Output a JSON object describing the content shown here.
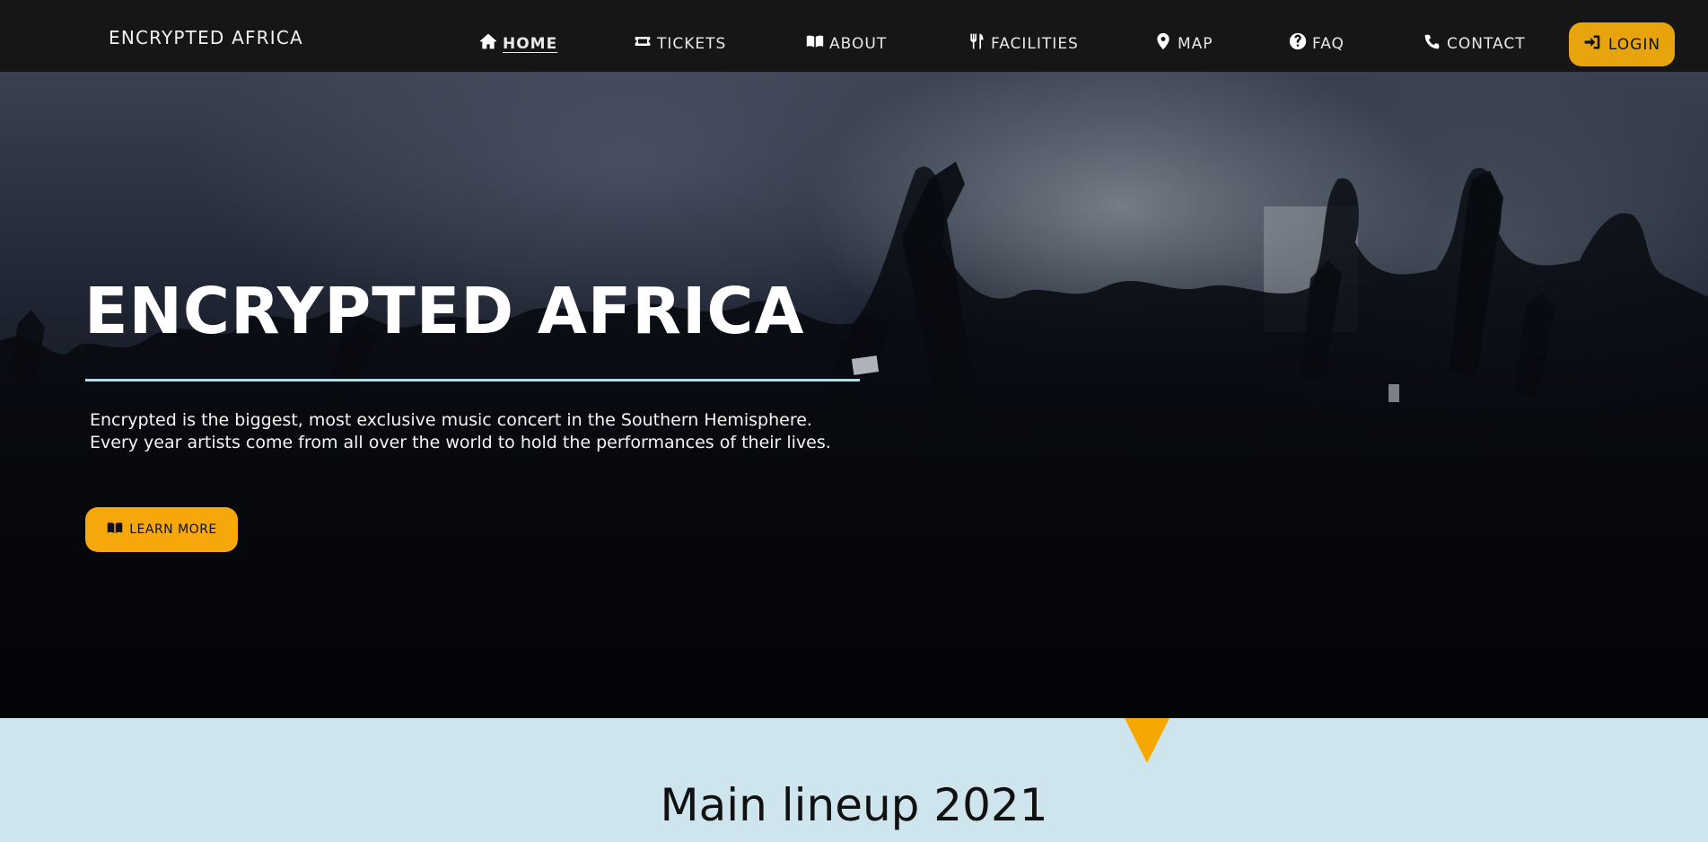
{
  "brand": "ENCRYPTED AFRICA",
  "nav": {
    "items": [
      {
        "label": "HOME",
        "icon": "home-icon",
        "active": true
      },
      {
        "label": "TICKETS",
        "icon": "ticket-icon"
      },
      {
        "label": "ABOUT",
        "icon": "book-open-icon"
      },
      {
        "label": "FACILITIES",
        "icon": "utensils-icon"
      },
      {
        "label": "MAP",
        "icon": "map-marker-icon"
      },
      {
        "label": "FAQ",
        "icon": "question-circle-icon"
      },
      {
        "label": "CONTACT",
        "icon": "phone-icon"
      }
    ],
    "login": {
      "label": "LOGIN",
      "icon": "sign-in-icon"
    }
  },
  "hero": {
    "title": "ENCRYPTED AFRICA",
    "line1": "Encrypted is the biggest, most exclusive music concert in the Southern Hemisphere.",
    "line2": "Every year artists come from all over the world to hold the performances of their lives.",
    "button": {
      "label": "LEARN MORE",
      "icon": "book-open-icon"
    }
  },
  "lineup": {
    "title": "Main lineup 2021"
  },
  "colors": {
    "accent": "#f6a70a",
    "nav_bg": "#161616",
    "section_bg": "#cfe5ee",
    "rule": "#b5dbe9"
  }
}
